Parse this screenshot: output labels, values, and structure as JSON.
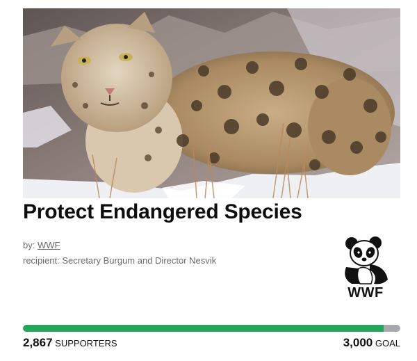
{
  "petition": {
    "title": "Protect Endangered Species",
    "by_prefix": "by:",
    "by_name": "WWF",
    "recipient_label": "recipient: Secretary Burgum and Director Nesvik"
  },
  "logo": {
    "text": "WWF"
  },
  "progress": {
    "supporters_count": "2,867",
    "supporters_label": "SUPPORTERS",
    "goal_count": "3,000",
    "goal_label": "GOAL",
    "fraction": 0.9557
  },
  "colors": {
    "progress_fill": "#22a85a",
    "progress_track": "#a7a9ac",
    "title": "#0e0e0e",
    "meta": "#6b6b6b"
  }
}
